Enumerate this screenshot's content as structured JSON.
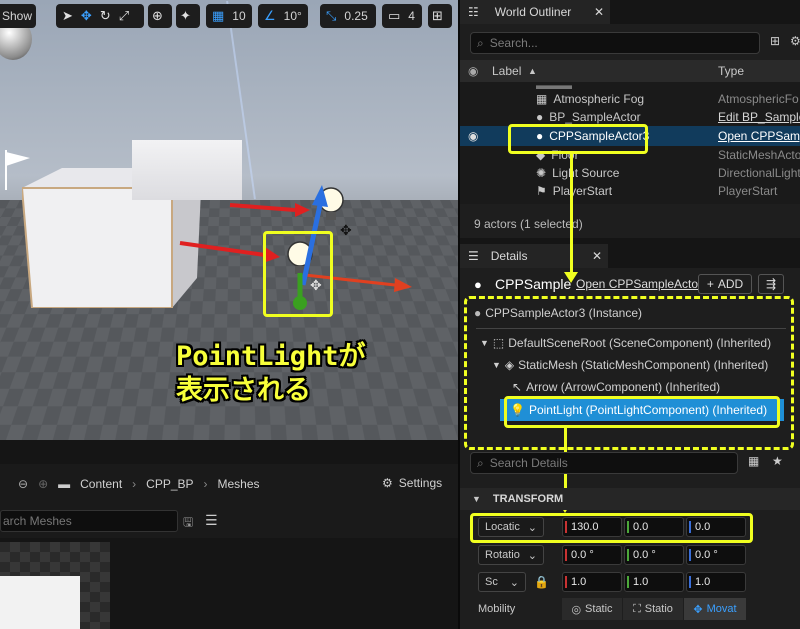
{
  "viewport": {
    "show_label": "Show",
    "grid_snap": "10",
    "rot_snap": "10°",
    "scale_snap": "0.25",
    "camera_speed": "4",
    "annotation_line1": "PointLightが",
    "annotation_line2": "表示される"
  },
  "content_browser": {
    "path": [
      "Content",
      "CPP_BP",
      "Meshes"
    ],
    "settings_label": "Settings",
    "search_placeholder": "arch Meshes"
  },
  "outliner": {
    "tab_title": "World Outliner",
    "search_placeholder": "Search...",
    "col_label": "Label",
    "col_type": "Type",
    "rows": [
      {
        "label": "Atmospheric Fog",
        "type": "AtmosphericFo"
      },
      {
        "label": "BP_SampleActor",
        "type": "Edit BP_Sample"
      },
      {
        "label": "CPPSampleActor3",
        "type": "Open CPPSamp"
      },
      {
        "label": "Floor",
        "type": "StaticMeshActo"
      },
      {
        "label": "Light Source",
        "type": "DirectionalLight"
      },
      {
        "label": "PlayerStart",
        "type": "PlayerStart"
      }
    ],
    "status": "9 actors (1 selected)"
  },
  "details": {
    "tab_title": "Details",
    "actor_name": "CPPSample",
    "open_link": "Open CPPSampleActor",
    "add_label": "ADD",
    "instance_label": "CPPSampleActor3 (Instance)",
    "components": [
      "DefaultSceneRoot (SceneComponent) (Inherited)",
      "StaticMesh (StaticMeshComponent) (Inherited)",
      "Arrow (ArrowComponent) (Inherited)",
      "PointLight (PointLightComponent) (Inherited)"
    ],
    "search_placeholder": "Search Details",
    "section_transform": "TRANSFORM",
    "location_label": "Locatic",
    "rotation_label": "Rotatio",
    "scale_label": "Sc",
    "location": [
      "130.0",
      "0.0",
      "0.0"
    ],
    "rotation": [
      "0.0 °",
      "0.0 °",
      "0.0 °"
    ],
    "scale": [
      "1.0",
      "1.0",
      "1.0"
    ],
    "mobility_label": "Mobility",
    "mobility_options": [
      "Static",
      "Statio",
      "Movat"
    ]
  },
  "colors": {
    "highlight": "#f0ff20",
    "selection": "#1f8fd6",
    "x_axis": "#c83232",
    "y_axis": "#4ca83a",
    "z_axis": "#3a6ed8"
  }
}
